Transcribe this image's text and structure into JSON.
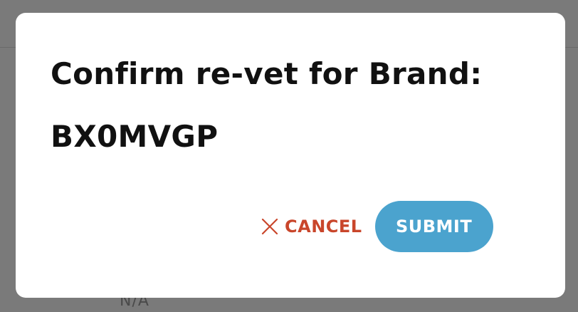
{
  "backdrop": {
    "partial_text": "N/A"
  },
  "modal": {
    "title_line_1": "Confirm re-vet for Brand:",
    "title_line_2": "BX0MVGP",
    "cancel_label": "CANCEL",
    "cancel_icon": "close-icon",
    "submit_label": "SUBMIT"
  },
  "colors": {
    "overlay": "#7a7a7a",
    "cancel": "#c9462b",
    "submit_bg": "#4ba3ce",
    "submit_text": "#ffffff",
    "title": "#111111"
  }
}
